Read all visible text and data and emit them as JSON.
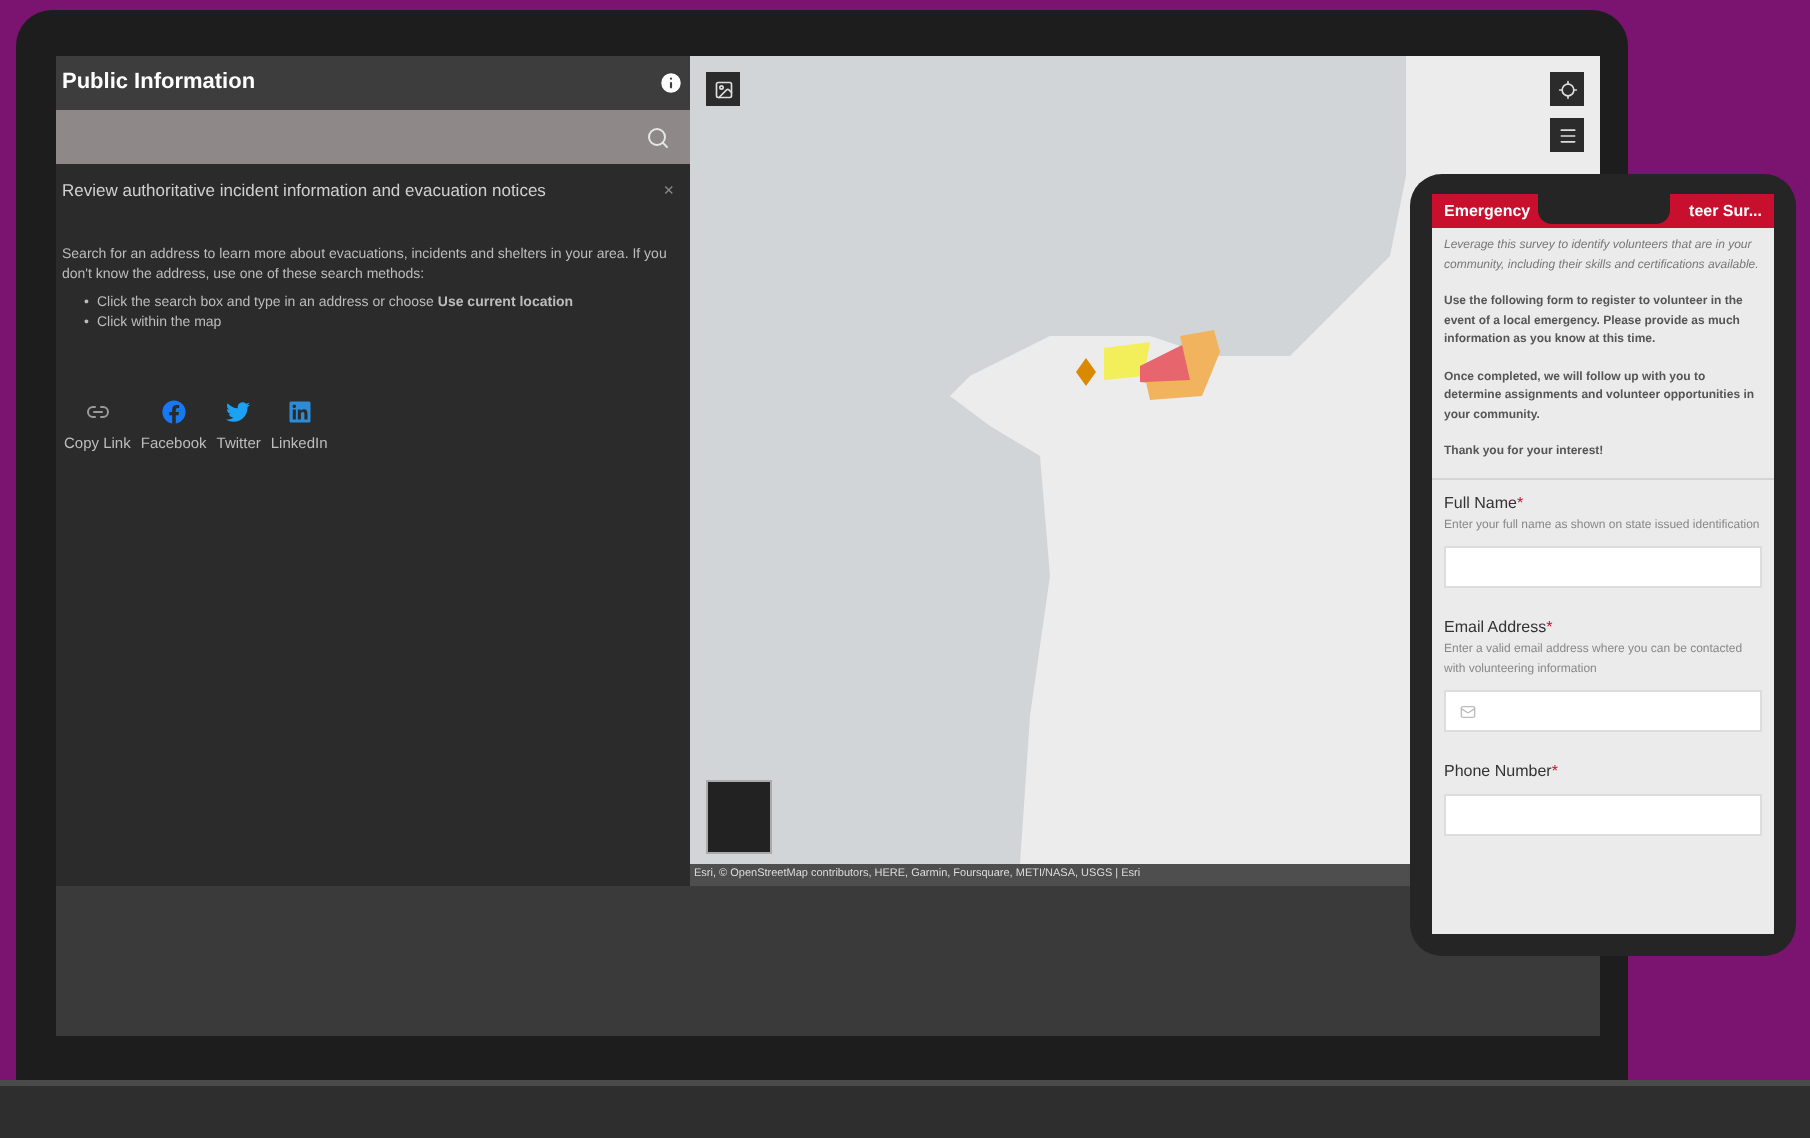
{
  "panel": {
    "title": "Public Information",
    "notice": "Review authoritative incident information and evacuation notices",
    "notice_close": "×",
    "intro": "Search for an address to learn more about evacuations, incidents and shelters in your area.  If you don't know the address, use one of these search methods:",
    "bullets": [
      {
        "marker": "•",
        "text": "Click the search box and type in an address or choose **Use current location**"
      },
      {
        "marker": "•",
        "text": "Click within the map"
      }
    ],
    "share": [
      {
        "kind": "link",
        "label": "Copy Link"
      },
      {
        "kind": "facebook",
        "label": "Facebook"
      },
      {
        "kind": "twitter",
        "label": "Twitter"
      },
      {
        "kind": "linkedin",
        "label": "LinkedIn"
      }
    ]
  },
  "map": {
    "attribution": "Esri, © OpenStreetMap contributors, HERE, Garmin, Foursquare, METI/NASA, USGS | Esri"
  },
  "survey": {
    "title_start": "Emergency",
    "title_end": "teer Sur...",
    "description": "Leverage this survey to identify volunteers that are in your community, including their skills and certifications available.",
    "paragraphs": [
      "Use the following form to register to volunteer in the event of a local emergency. Please provide as much information as you know at this time.",
      "Once completed, we will follow up with you to determine assignments and volunteer opportunities in your community.",
      "Thank you for your interest!"
    ],
    "fields": [
      {
        "kind": "text",
        "label": "Full Name",
        "required_mark": "*",
        "hint": "Enter your full name as shown on state issued identification"
      },
      {
        "kind": "email",
        "label": "Email Address",
        "required_mark": "*",
        "hint": "Enter a valid email address where you can be contacted with volunteering information"
      },
      {
        "kind": "text",
        "label": "Phone Number",
        "required_mark": "*"
      }
    ]
  }
}
